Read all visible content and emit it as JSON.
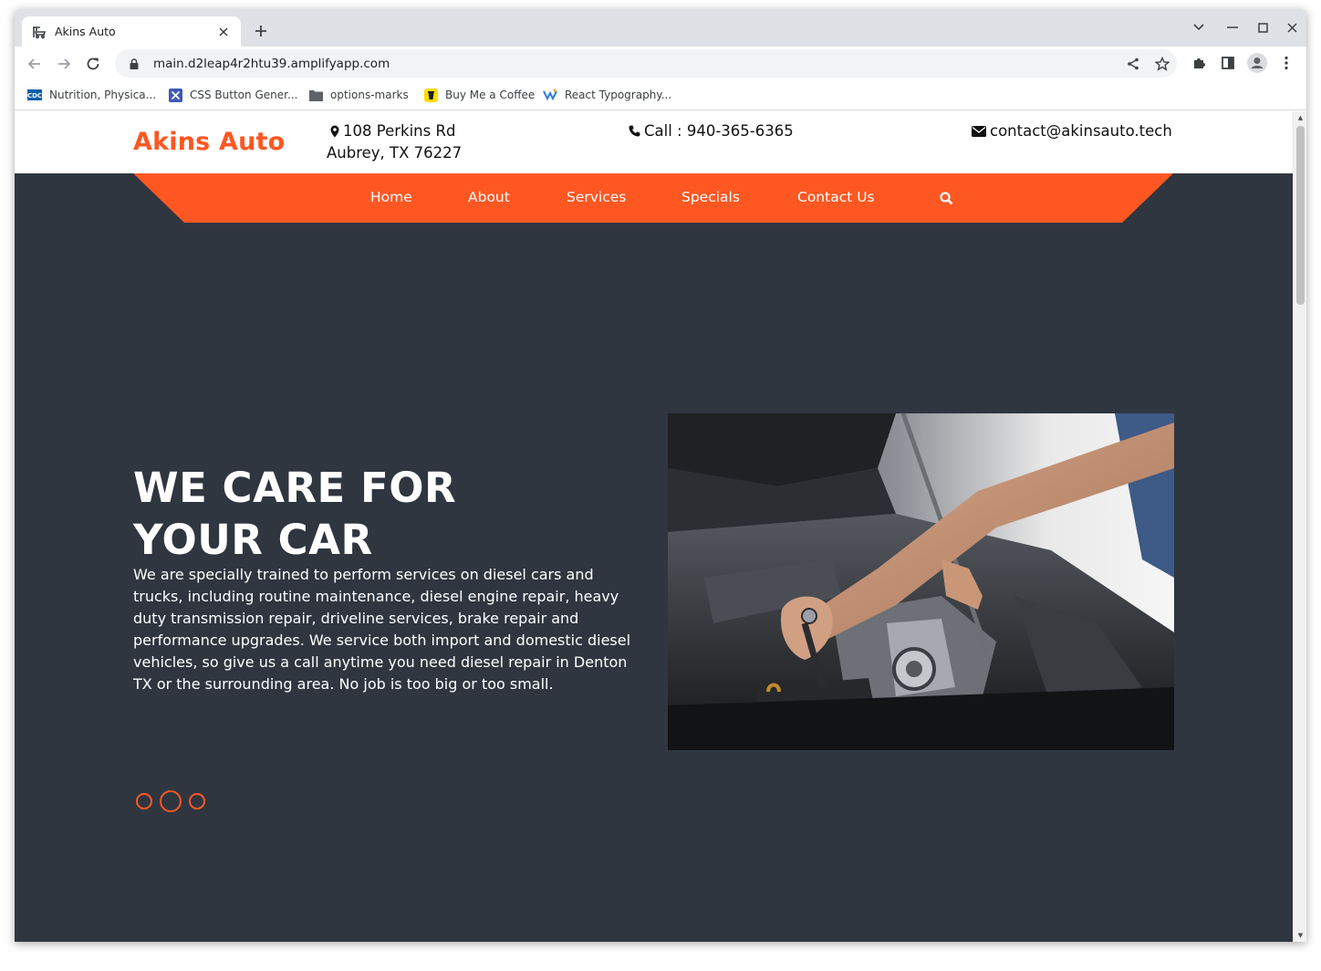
{
  "browser": {
    "tab_title": "Akins Auto",
    "new_tab": "+",
    "url": "main.d2leap4r2htu39.amplifyapp.com",
    "bookmarks": [
      {
        "label": "Nutrition, Physica...",
        "icon": "cdc-icon"
      },
      {
        "label": "CSS Button Gener...",
        "icon": "css-button-icon"
      },
      {
        "label": "options-marks",
        "icon": "folder-icon"
      },
      {
        "label": "Buy Me a Coffee",
        "icon": "coffee-icon"
      },
      {
        "label": "React Typography...",
        "icon": "react-typography-icon"
      }
    ],
    "bookmark_cdc_text": "CDC"
  },
  "site": {
    "logo": "Akins Auto",
    "address_line1": "108 Perkins Rd",
    "address_line2": "Aubrey, TX 76227",
    "phone": "Call : 940-365-6365",
    "email": "contact@akinsauto.tech",
    "nav": [
      "Home",
      "About",
      "Services",
      "Specials",
      "Contact Us"
    ],
    "hero_title_line1": "WE CARE FOR",
    "hero_title_line2": "YOUR CAR",
    "hero_text": "We are specially trained to perform services on diesel cars and trucks, including routine maintenance, diesel engine repair, heavy duty transmission repair, driveline services, brake repair and performance upgrades. We service both import and domestic diesel vehicles, so give us a call anytime you need diesel repair in Denton TX or the surrounding area. No job is too big or too small.",
    "slider": {
      "slides": 3,
      "active": 2
    }
  },
  "colors": {
    "accent": "#ff5722",
    "hero_bg": "#2f3640",
    "header_bg": "#ffffff",
    "tab_strip": "#dee1e6"
  }
}
